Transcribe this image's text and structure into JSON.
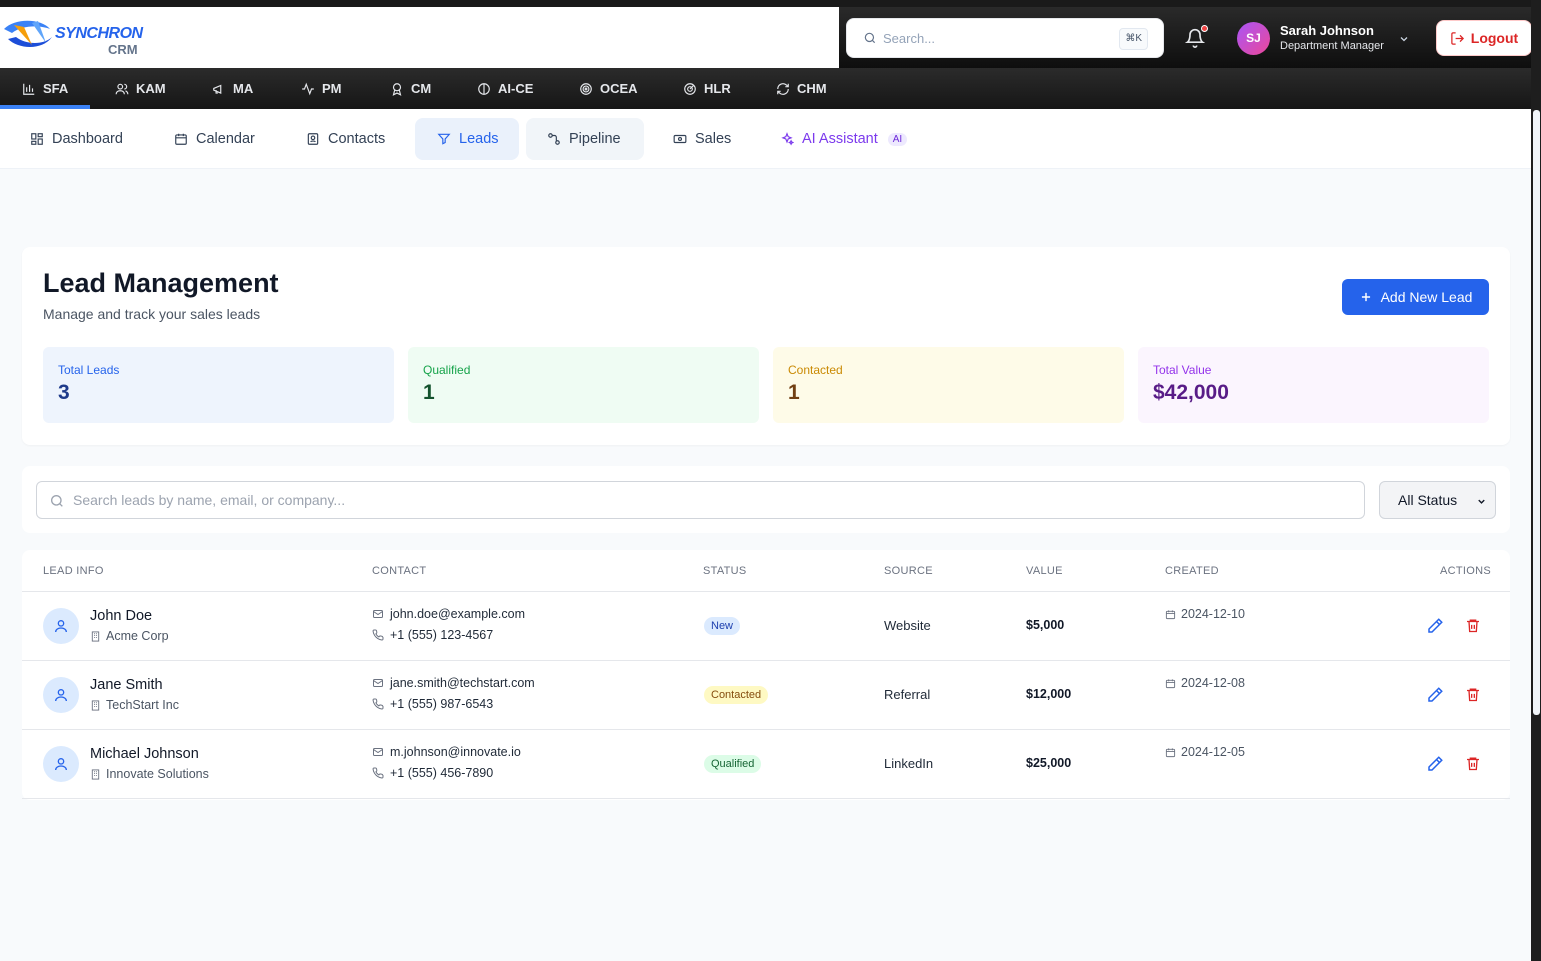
{
  "brand": {
    "name": "SYNCHRON",
    "sub": "CRM",
    "logo_icon": "synchron-logo"
  },
  "header": {
    "search_placeholder": "Search...",
    "shortcut": "⌘K",
    "user": {
      "initials": "SJ",
      "name": "Sarah Johnson",
      "role": "Department Manager"
    },
    "logout_label": "Logout"
  },
  "modules": [
    {
      "label": "SFA",
      "icon": "bar-chart-icon",
      "active": true
    },
    {
      "label": "KAM",
      "icon": "users-icon"
    },
    {
      "label": "MA",
      "icon": "megaphone-icon"
    },
    {
      "label": "PM",
      "icon": "activity-icon"
    },
    {
      "label": "CM",
      "icon": "award-icon"
    },
    {
      "label": "AI-CE",
      "icon": "brain-icon"
    },
    {
      "label": "OCEA",
      "icon": "target-icon"
    },
    {
      "label": "HLR",
      "icon": "radar-icon"
    },
    {
      "label": "CHM",
      "icon": "refresh-icon"
    }
  ],
  "nav": [
    {
      "label": "Dashboard",
      "icon": "dashboard-icon"
    },
    {
      "label": "Calendar",
      "icon": "calendar-icon"
    },
    {
      "label": "Contacts",
      "icon": "contact-book-icon"
    },
    {
      "label": "Leads",
      "icon": "filter-icon",
      "active": true
    },
    {
      "label": "Pipeline",
      "icon": "pipeline-icon"
    },
    {
      "label": "Sales",
      "icon": "money-icon"
    },
    {
      "label": "AI Assistant",
      "icon": "sparkles-icon",
      "badge": "AI"
    }
  ],
  "page": {
    "title": "Lead Management",
    "subtitle": "Manage and track your sales leads",
    "add_button": "Add New Lead"
  },
  "stats": [
    {
      "label": "Total Leads",
      "value": "3",
      "bg": "#eef4fd",
      "label_color": "#2563eb",
      "value_color": "#1e3a8a"
    },
    {
      "label": "Qualified",
      "value": "1",
      "bg": "#effcf3",
      "label_color": "#16a34a",
      "value_color": "#14532d"
    },
    {
      "label": "Contacted",
      "value": "1",
      "bg": "#fefbe8",
      "label_color": "#ca8a04",
      "value_color": "#713f12"
    },
    {
      "label": "Total Value",
      "value": "$42,000",
      "bg": "#fbf5fe",
      "label_color": "#9333ea",
      "value_color": "#581c87"
    }
  ],
  "filter": {
    "search_placeholder": "Search leads by name, email, or company...",
    "status_selected": "All Status"
  },
  "table": {
    "columns": [
      "LEAD INFO",
      "CONTACT",
      "STATUS",
      "SOURCE",
      "VALUE",
      "CREATED",
      "ACTIONS"
    ],
    "rows": [
      {
        "name": "John Doe",
        "company": "Acme Corp",
        "email": "john.doe@example.com",
        "phone": "+1 (555) 123-4567",
        "status": "New",
        "source": "Website",
        "value": "$5,000",
        "created": "2024-12-10"
      },
      {
        "name": "Jane Smith",
        "company": "TechStart Inc",
        "email": "jane.smith@techstart.com",
        "phone": "+1 (555) 987-6543",
        "status": "Contacted",
        "source": "Referral",
        "value": "$12,000",
        "created": "2024-12-08"
      },
      {
        "name": "Michael Johnson",
        "company": "Innovate Solutions",
        "email": "m.johnson@innovate.io",
        "phone": "+1 (555) 456-7890",
        "status": "Qualified",
        "source": "LinkedIn",
        "value": "$25,000",
        "created": "2024-12-05"
      }
    ]
  },
  "status_colors": {
    "New": {
      "bg": "#dbeafe",
      "fg": "#1e40af"
    },
    "Contacted": {
      "bg": "#fef9c3",
      "fg": "#854d0e"
    },
    "Qualified": {
      "bg": "#dcfce7",
      "fg": "#166534"
    }
  }
}
